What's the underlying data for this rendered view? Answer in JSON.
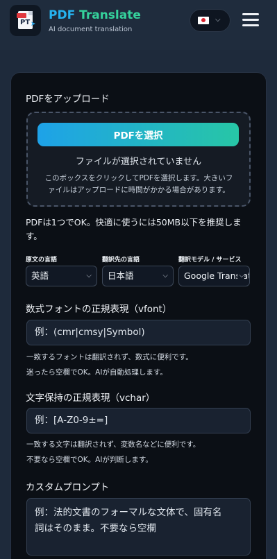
{
  "header": {
    "brand_part1": "PDF",
    "brand_part2": "Translate",
    "subtitle": "AI document translation",
    "logo_badge": "PDF",
    "logo_text": "PT",
    "language_flag": "jp-flag",
    "menu_icon": "hamburger-icon"
  },
  "upload": {
    "label": "PDFをアップロード",
    "button_label": "PDFを選択",
    "no_file_text": "ファイルが選択されていません",
    "hint_line1": "このボックスをクリックしてPDFを選択します。大きいフ",
    "hint_line2": "ァイルはアップロードに時間がかかる場合があります。",
    "note_line1": "PDFは1つでOK。快適に使うには50MB以下を推奨しま",
    "note_line2": "す。"
  },
  "languages": {
    "source_label": "原文の言語",
    "source_value": "英語",
    "target_label": "翻訳先の言語",
    "target_value": "日本語",
    "model_label": "翻訳モデル / サービス",
    "model_value": "Google Translate"
  },
  "vfont": {
    "label": "数式フォントの正規表現（vfont）",
    "placeholder": "例：(cmr|cmsy|Symbol)",
    "help_line1": "一致するフォントは翻訳されず、数式に便利です。",
    "help_line2": "迷ったら空欄でOK。AIが自動処理します。"
  },
  "vchar": {
    "label": "文字保持の正規表現（vchar）",
    "placeholder": "例：[A-Z0-9±=]",
    "help_line1": "一致する文字は翻訳されず、変数名などに便利です。",
    "help_line2": "不要なら空欄でOK。AIが判断します。"
  },
  "prompt": {
    "label": "カスタムプロンプト",
    "placeholder_line1": "例：法的文書のフォーマルな文体で、固有名",
    "placeholder_line2": "詞はそのまま。不要なら空欄"
  },
  "colors": {
    "background": "#1e2a3b",
    "card": "#0b0f15",
    "accent_blue": "#26b3f0",
    "accent_green": "#35d29c"
  }
}
